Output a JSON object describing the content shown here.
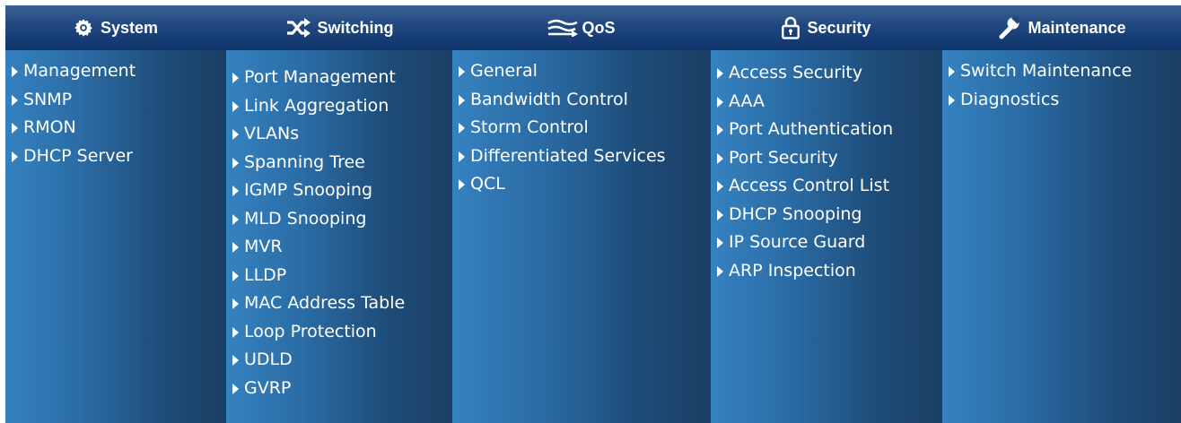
{
  "menu": {
    "columns": [
      {
        "title": "System",
        "icon": "gear-icon",
        "items": [
          "Management",
          "SNMP",
          "RMON",
          "DHCP Server"
        ]
      },
      {
        "title": "Switching",
        "icon": "shuffle-icon",
        "items": [
          "Port Management",
          "Link Aggregation",
          "VLANs",
          "Spanning Tree",
          "IGMP Snooping",
          "MLD Snooping",
          "MVR",
          "LLDP",
          "MAC Address Table",
          "Loop Protection",
          "UDLD",
          "GVRP"
        ]
      },
      {
        "title": "QoS",
        "icon": "qos-waves-icon",
        "items": [
          "General",
          "Bandwidth Control",
          "Storm Control",
          "Differentiated Services",
          "QCL"
        ]
      },
      {
        "title": "Security",
        "icon": "lock-icon",
        "items": [
          "Access Security",
          "AAA",
          "Port Authentication",
          "Port Security",
          "Access Control List",
          "DHCP Snooping",
          "IP Source Guard",
          "ARP Inspection"
        ]
      },
      {
        "title": "Maintenance",
        "icon": "wrench-icon",
        "items": [
          "Switch Maintenance",
          "Diagnostics"
        ]
      }
    ],
    "colors": {
      "header_top": "#3d6096",
      "header_bottom": "#0d336a",
      "column_light": "#3582c0",
      "column_dark": "#1b3f63",
      "text": "#ffffff"
    }
  }
}
